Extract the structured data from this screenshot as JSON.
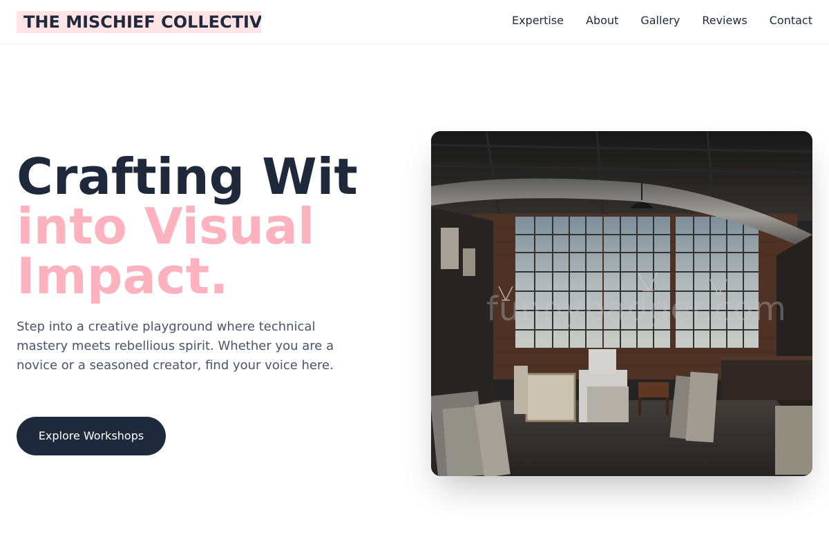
{
  "header": {
    "logo": "THE MISCHIEF COLLECTIVE",
    "nav": [
      "Expertise",
      "About",
      "Gallery",
      "Reviews",
      "Contact"
    ]
  },
  "hero": {
    "title_line1": "Crafting Wit",
    "title_line2": "into Visual",
    "title_line3": "Impact.",
    "description": "Step into a creative playground where technical mastery meets rebellious spirit. Whether you are a novice or a seasoned creator, find your voice here.",
    "cta_label": "Explore Workshops"
  },
  "image": {
    "watermark": "funnybadger.com",
    "subject": "industrial art studio loft"
  },
  "colors": {
    "primary": "#1e293b",
    "accent_pink": "#fdb2be",
    "logo_bg": "#ffe4e6",
    "text_muted": "#475569"
  }
}
